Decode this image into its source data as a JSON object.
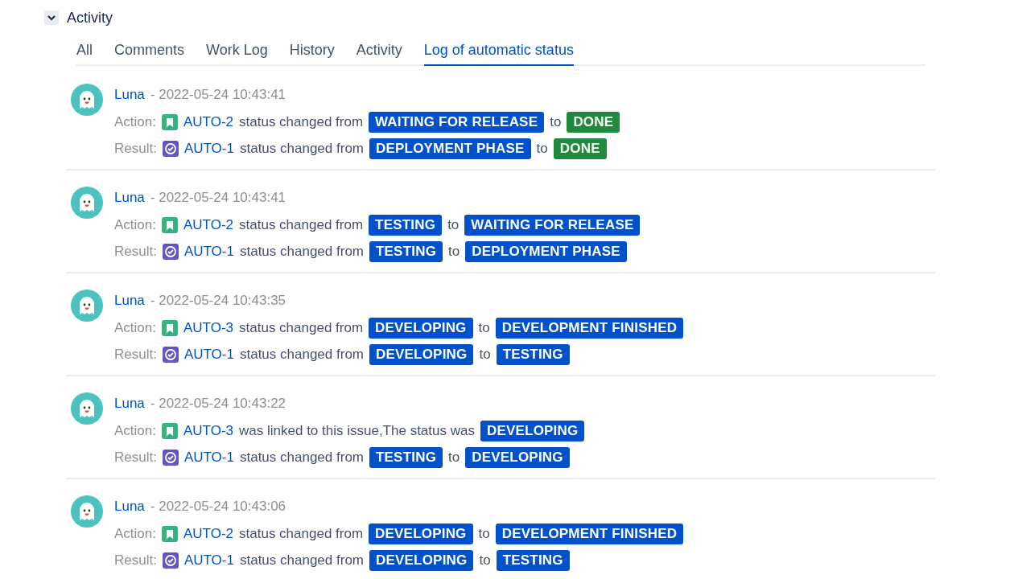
{
  "section": {
    "title": "Activity",
    "expanded": true
  },
  "tabs": [
    {
      "label": "All",
      "selected": false
    },
    {
      "label": "Comments",
      "selected": false
    },
    {
      "label": "Work Log",
      "selected": false
    },
    {
      "label": "History",
      "selected": false
    },
    {
      "label": "Activity",
      "selected": false
    },
    {
      "label": "Log of automatic status",
      "selected": true
    }
  ],
  "entries": [
    {
      "author": "Luna",
      "time": "- 2022-05-24 10:43:41",
      "lines": [
        {
          "label": "Action:",
          "kind": "story",
          "key": "AUTO-2",
          "text": "status changed from",
          "from": {
            "status": "WAITING FOR RELEASE",
            "color": "#0052cc"
          },
          "joiner": "to",
          "to": {
            "status": "DONE",
            "color": "#1e8a3c"
          }
        },
        {
          "label": "Result:",
          "kind": "subtask",
          "key": "AUTO-1",
          "text": "status changed from",
          "from": {
            "status": "DEPLOYMENT PHASE",
            "color": "#0052cc"
          },
          "joiner": "to",
          "to": {
            "status": "DONE",
            "color": "#1e8a3c"
          }
        }
      ]
    },
    {
      "author": "Luna",
      "time": "- 2022-05-24 10:43:41",
      "lines": [
        {
          "label": "Action:",
          "kind": "story",
          "key": "AUTO-2",
          "text": "status changed from",
          "from": {
            "status": "TESTING",
            "color": "#0052cc"
          },
          "joiner": "to",
          "to": {
            "status": "WAITING FOR RELEASE",
            "color": "#0052cc"
          }
        },
        {
          "label": "Result:",
          "kind": "subtask",
          "key": "AUTO-1",
          "text": "status changed from",
          "from": {
            "status": "TESTING",
            "color": "#0052cc"
          },
          "joiner": "to",
          "to": {
            "status": "DEPLOYMENT PHASE",
            "color": "#0052cc"
          }
        }
      ]
    },
    {
      "author": "Luna",
      "time": "- 2022-05-24 10:43:35",
      "lines": [
        {
          "label": "Action:",
          "kind": "story",
          "key": "AUTO-3",
          "text": "status changed from",
          "from": {
            "status": "DEVELOPING",
            "color": "#0052cc"
          },
          "joiner": "to",
          "to": {
            "status": "DEVELOPMENT FINISHED",
            "color": "#0052cc"
          }
        },
        {
          "label": "Result:",
          "kind": "subtask",
          "key": "AUTO-1",
          "text": "status changed from",
          "from": {
            "status": "DEVELOPING",
            "color": "#0052cc"
          },
          "joiner": "to",
          "to": {
            "status": "TESTING",
            "color": "#0052cc"
          }
        }
      ]
    },
    {
      "author": "Luna",
      "time": "- 2022-05-24 10:43:22",
      "lines": [
        {
          "label": "Action:",
          "kind": "story",
          "key": "AUTO-3",
          "text": "was linked to this issue,The status was",
          "from": {
            "status": "DEVELOPING",
            "color": "#0052cc"
          }
        },
        {
          "label": "Result:",
          "kind": "subtask",
          "key": "AUTO-1",
          "text": "status changed from",
          "from": {
            "status": "TESTING",
            "color": "#0052cc"
          },
          "joiner": "to",
          "to": {
            "status": "DEVELOPING",
            "color": "#0052cc"
          }
        }
      ]
    },
    {
      "author": "Luna",
      "time": "- 2022-05-24 10:43:06",
      "lines": [
        {
          "label": "Action:",
          "kind": "story",
          "key": "AUTO-2",
          "text": "status changed from",
          "from": {
            "status": "DEVELOPING",
            "color": "#0052cc"
          },
          "joiner": "to",
          "to": {
            "status": "DEVELOPMENT FINISHED",
            "color": "#0052cc"
          }
        },
        {
          "label": "Result:",
          "kind": "subtask",
          "key": "AUTO-1",
          "text": "status changed from",
          "from": {
            "status": "DEVELOPING",
            "color": "#0052cc"
          },
          "joiner": "to",
          "to": {
            "status": "TESTING",
            "color": "#0052cc"
          }
        }
      ]
    }
  ]
}
